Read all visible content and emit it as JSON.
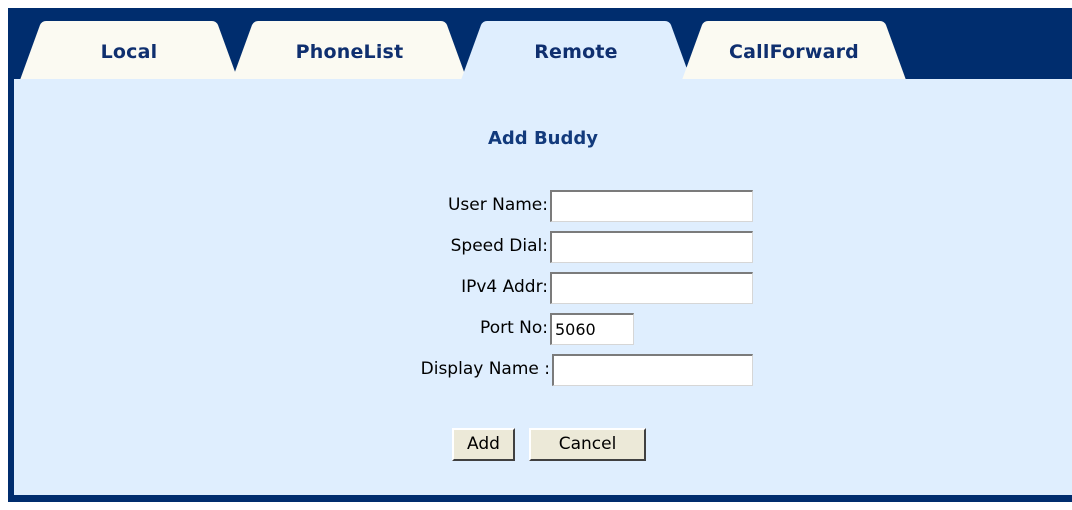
{
  "tabs": [
    {
      "label": "Local",
      "active": false
    },
    {
      "label": "PhoneList",
      "active": false
    },
    {
      "label": "Remote",
      "active": true
    },
    {
      "label": "CallForward",
      "active": false
    }
  ],
  "form": {
    "title": "Add Buddy",
    "fields": {
      "user_name": {
        "label": "User Name:",
        "value": ""
      },
      "speed_dial": {
        "label": "Speed Dial:",
        "value": ""
      },
      "ipv4_addr": {
        "label": "IPv4 Addr:",
        "value": ""
      },
      "port_no": {
        "label": "Port No:",
        "value": "5060"
      },
      "display_name": {
        "label": "Display Name :",
        "value": ""
      }
    },
    "buttons": {
      "add": "Add",
      "cancel": "Cancel"
    }
  },
  "colors": {
    "frame": "#002d6e",
    "panel": "#dfeefe",
    "tab_inactive": "#fbfaf2",
    "tab_active": "#dfeefe",
    "heading_text": "#123a7c"
  }
}
